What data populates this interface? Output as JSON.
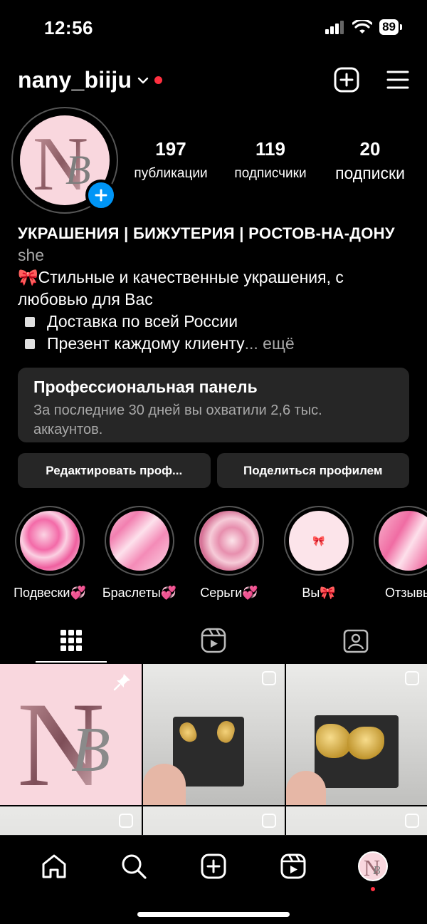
{
  "status": {
    "time": "12:56",
    "battery": "89"
  },
  "header": {
    "username": "nany_biiju"
  },
  "avatar": {
    "monogram_main": "N",
    "monogram_sub": "B"
  },
  "stats": [
    {
      "value": "197",
      "label": "публикации"
    },
    {
      "value": "119",
      "label": "подписчики"
    },
    {
      "value": "20",
      "label": "подписки"
    }
  ],
  "bio": {
    "title": "УКРАШЕНИЯ | БИЖУТЕРИЯ | РОСТОВ-НА-ДОНУ",
    "pronoun": "she",
    "line1": "🎀Стильные и качественные украшения, с любовью для Вас",
    "line2": "Доставка по всей России",
    "line3": "Презент каждому клиенту",
    "more": "... ещё"
  },
  "pro_panel": {
    "title": "Профессиональная панель",
    "subtitle": "За последние 30 дней вы охватили 2,6 тыс. аккаунтов."
  },
  "buttons": {
    "edit": "Редактировать проф...",
    "share": "Поделиться профилем"
  },
  "highlights": [
    {
      "label": "Подвески💞"
    },
    {
      "label": "Браслеты💞"
    },
    {
      "label": "Серьги💞"
    },
    {
      "label": "Вы🎀"
    },
    {
      "label": "Отзывы"
    }
  ],
  "colors": {
    "accent": "#0095f6",
    "notification": "#ff3040",
    "panel": "#262626",
    "pink": "#f9d7de"
  }
}
